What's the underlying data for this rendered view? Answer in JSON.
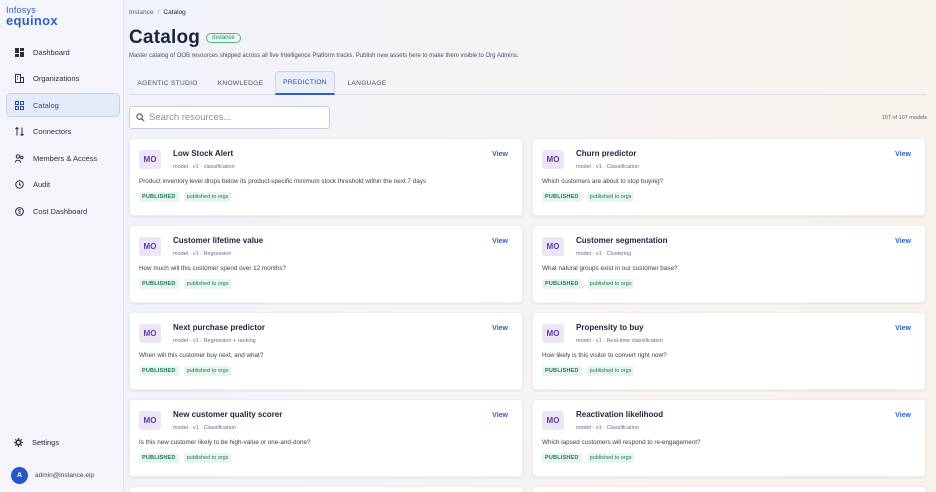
{
  "brand": {
    "line1": "Infosys",
    "line2": "equinox"
  },
  "sidebar": {
    "items": [
      {
        "label": "Dashboard",
        "icon": "dashboard-icon",
        "active": false
      },
      {
        "label": "Organizations",
        "icon": "building-icon",
        "active": false
      },
      {
        "label": "Catalog",
        "icon": "grid-icon",
        "active": true
      },
      {
        "label": "Connectors",
        "icon": "connector-icon",
        "active": false
      },
      {
        "label": "Members & Access",
        "icon": "users-icon",
        "active": false
      },
      {
        "label": "Audit",
        "icon": "history-icon",
        "active": false
      },
      {
        "label": "Cost Dashboard",
        "icon": "dollar-icon",
        "active": false
      }
    ],
    "settings_label": "Settings",
    "user": {
      "initial": "A",
      "email": "admin@instance.eip"
    }
  },
  "breadcrumb": {
    "root": "Instance",
    "sep": "/",
    "current": "Catalog"
  },
  "header": {
    "title": "Catalog",
    "badge": "Instance",
    "subtitle": "Master catalog of OOB resources shipped across all five Intelligence Platform tracks. Publish new assets here to make them visible to Org Admins."
  },
  "tabs": [
    {
      "label": "AGENTIC STUDIO",
      "active": false
    },
    {
      "label": "KNOWLEDGE",
      "active": false
    },
    {
      "label": "PREDICTION",
      "active": true
    },
    {
      "label": "LANGUAGE",
      "active": false
    }
  ],
  "search": {
    "placeholder": "Search resources...",
    "value": ""
  },
  "count_label": "107 of 107 models",
  "view_label": "View",
  "badge_published": "PUBLISHED",
  "badge_orgs": "published to orgs",
  "cards": [
    {
      "abbr": "MO",
      "title": "Low Stock Alert",
      "meta": "model · v1 · classification",
      "desc": "Product inventory level drops below its product-specific minimum stock threshold within the next 7 days"
    },
    {
      "abbr": "MO",
      "title": "Churn predictor",
      "meta": "model · v1 · Classification",
      "desc": "Which customers are about to stop buying?"
    },
    {
      "abbr": "MO",
      "title": "Customer lifetime value",
      "meta": "model · v1 · Regression",
      "desc": "How much will this customer spend over 12 months?"
    },
    {
      "abbr": "MO",
      "title": "Customer segmentation",
      "meta": "model · v1 · Clustering",
      "desc": "What natural groups exist in our customer base?"
    },
    {
      "abbr": "MO",
      "title": "Next purchase predictor",
      "meta": "model · v1 · Regression + ranking",
      "desc": "When will this customer buy next, and what?"
    },
    {
      "abbr": "MO",
      "title": "Propensity to buy",
      "meta": "model · v1 · Real-time classification",
      "desc": "How likely is this visitor to convert right now?"
    },
    {
      "abbr": "MO",
      "title": "New customer quality scorer",
      "meta": "model · v1 · Classification",
      "desc": "Is this new customer likely to be high-value or one-and-done?"
    },
    {
      "abbr": "MO",
      "title": "Reactivation likelihood",
      "meta": "model · v1 · Classification",
      "desc": "Which lapsed customers will respond to re-engagement?"
    }
  ]
}
